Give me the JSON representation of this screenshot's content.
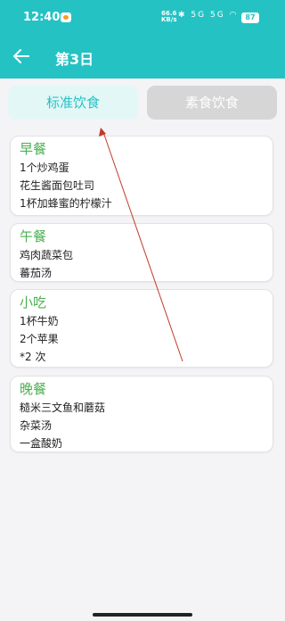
{
  "status_bar": {
    "time": "12:40",
    "net_speed_value": "66.6",
    "net_speed_unit": "KB/s",
    "signal_text": "5G 5G",
    "battery": "87"
  },
  "header": {
    "title": "第3日",
    "back_icon": "arrow-left-icon"
  },
  "tabs": [
    {
      "label": "标准饮食",
      "active": true
    },
    {
      "label": "素食饮食",
      "active": false
    }
  ],
  "meals": [
    {
      "title": "早餐",
      "items": [
        "1个炒鸡蛋",
        "花生酱面包吐司",
        "1杯加蜂蜜的柠檬汁"
      ]
    },
    {
      "title": "午餐",
      "items": [
        "鸡肉蔬菜包",
        "蕃茄汤"
      ]
    },
    {
      "title": "小吃",
      "items": [
        "1杯牛奶",
        "2个苹果",
        "*2 次"
      ]
    },
    {
      "title": "晚餐",
      "items": [
        "糙米三文鱼和蘑菇",
        "杂菜汤",
        "一盒酸奶"
      ]
    }
  ],
  "colors": {
    "primary": "#25c2c4",
    "meal_title": "#4caf50",
    "annotation_arrow": "#c0392b"
  }
}
